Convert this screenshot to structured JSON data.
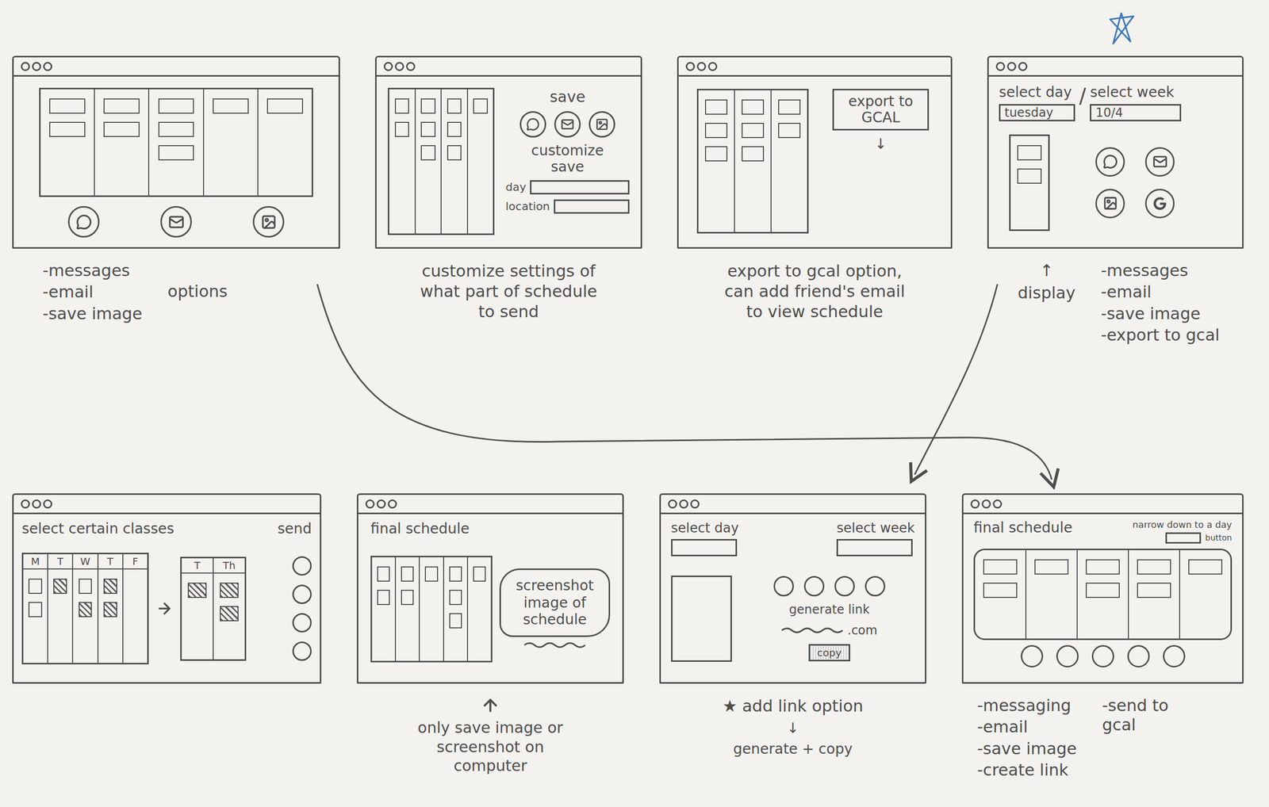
{
  "top_row": [
    {
      "kind": "share-options",
      "schedule": {
        "columns": [
          [
            false,
            false
          ],
          [
            false,
            false
          ],
          [
            false,
            false,
            false
          ],
          [
            false
          ],
          [
            false
          ]
        ]
      },
      "notes": {
        "items": [
          "-messages",
          "-email",
          "-save image"
        ],
        "side": "options"
      }
    },
    {
      "kind": "customize-save",
      "save_label": "save",
      "customize_label": "customize save",
      "fields": [
        "day",
        "location"
      ],
      "schedule": {
        "columns": [
          [
            false,
            false
          ],
          [
            false,
            false,
            false
          ],
          [
            false,
            false,
            false
          ],
          [
            false
          ]
        ]
      },
      "notes": {
        "text": "customize settings of what part of schedule to send"
      }
    },
    {
      "kind": "export-gcal",
      "export_button": "export to GCAL",
      "export_arrow": "↓",
      "schedule": {
        "columns": [
          [
            false,
            false,
            false
          ],
          [
            false,
            false,
            false
          ],
          [
            false,
            false
          ]
        ]
      },
      "notes": {
        "text": "export to gcal option, can add friend's email to view schedule"
      }
    },
    {
      "kind": "select-range",
      "day_label": "select day",
      "separator": "/",
      "week_label": "select week",
      "day_value": "tuesday",
      "week_value": "10/4",
      "day_schedule": {
        "columns": [
          [
            false,
            false
          ]
        ]
      },
      "notes": {
        "pointer": "↑",
        "pointer_label": "display",
        "items": [
          "-messages",
          "-email",
          "-save image",
          "-export to gcal"
        ]
      }
    }
  ],
  "bottom_row": [
    {
      "kind": "select-classes",
      "title": "select certain classes",
      "send_label": "send",
      "week": {
        "headers": [
          "M",
          "T",
          "W",
          "T",
          "F"
        ],
        "columns": [
          [
            false,
            false
          ],
          [
            true
          ],
          [
            false,
            true
          ],
          [
            true,
            true
          ],
          []
        ]
      },
      "selection": {
        "headers": [
          "T",
          "Th"
        ],
        "columns": [
          [
            true
          ],
          [
            true,
            true
          ]
        ]
      }
    },
    {
      "kind": "final-image",
      "title": "final schedule",
      "bubble": "screenshot image of schedule",
      "schedule": {
        "columns": [
          [
            false,
            false
          ],
          [
            false,
            false
          ],
          [
            false
          ],
          [
            false,
            false,
            false
          ],
          [
            false
          ]
        ]
      },
      "notes": {
        "text": "only save image or screenshot on computer"
      }
    },
    {
      "kind": "link",
      "day_label": "select day",
      "week_label": "select week",
      "link_label": "generate link",
      "link_suffix": ".com",
      "copy_button": "copy",
      "notes": {
        "title": "★ add link option",
        "arrow": "↓",
        "text": "generate + copy"
      }
    },
    {
      "kind": "final-options",
      "title": "final schedule",
      "narrow_label": "narrow down to a day",
      "button_label": "button",
      "schedule": {
        "columns": [
          [
            false,
            false
          ],
          [
            false
          ],
          [
            false,
            false
          ],
          [
            false,
            false
          ],
          [
            false
          ]
        ]
      },
      "notes": {
        "items": [
          "-messaging",
          "-email",
          "-save image",
          "-create link"
        ],
        "side_items": [
          "-send to gcal"
        ]
      }
    }
  ]
}
